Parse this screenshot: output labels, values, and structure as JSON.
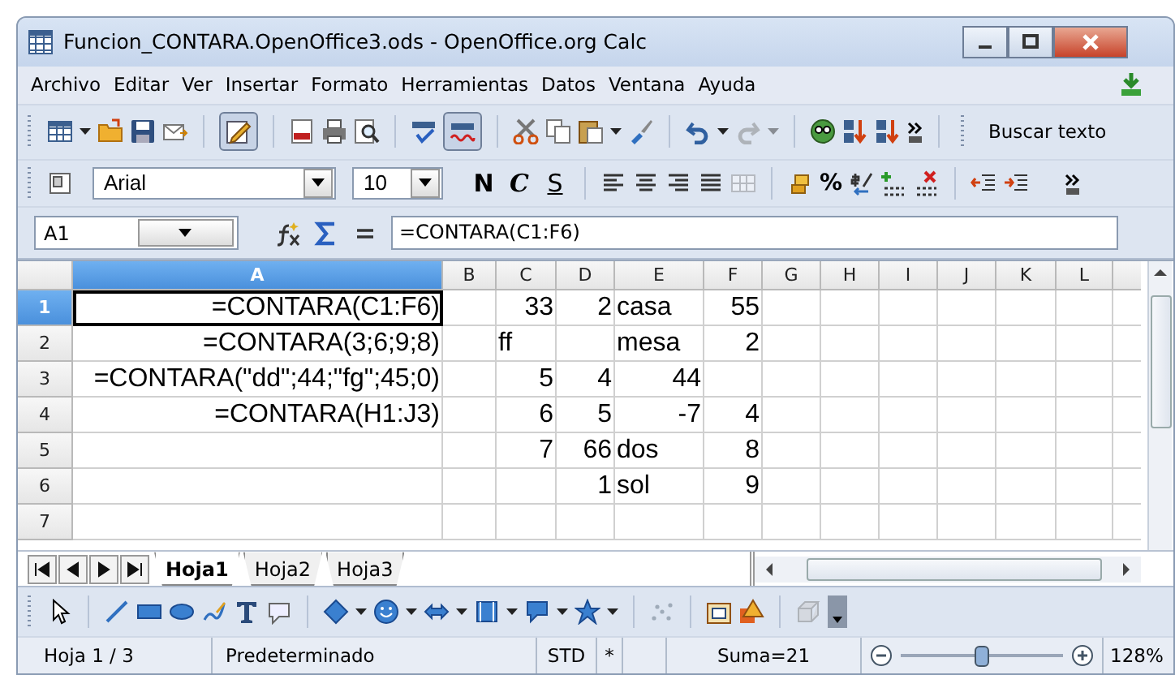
{
  "window": {
    "title": "Funcion_CONTARA.OpenOffice3.ods - OpenOffice.org Calc"
  },
  "menu": [
    {
      "label": "Archivo"
    },
    {
      "label": "Editar"
    },
    {
      "label": "Ver"
    },
    {
      "label": "Insertar"
    },
    {
      "label": "Formato"
    },
    {
      "label": "Herramientas"
    },
    {
      "label": "Datos"
    },
    {
      "label": "Ventana"
    },
    {
      "label": "Ayuda"
    }
  ],
  "standard_toolbar": {
    "edit_mode_pressed": true,
    "autospell_pressed": true,
    "redo_disabled": true,
    "search": {
      "placeholder": "Buscar texto"
    }
  },
  "formatting_toolbar": {
    "font": "Arial",
    "size": "10",
    "style_buttons": [
      {
        "label": "N",
        "kind": "bold"
      },
      {
        "label": "C",
        "kind": "italic"
      },
      {
        "label": "S",
        "kind": "underline"
      }
    ],
    "percent_button": "%",
    "merge_disabled": true
  },
  "formula_bar": {
    "name_box": "A1",
    "formula": "=CONTARA(C1:F6)"
  },
  "sheet": {
    "columns": [
      {
        "label": "A",
        "selected": true
      },
      {
        "label": "B",
        "selected": false
      },
      {
        "label": "C",
        "selected": false
      },
      {
        "label": "D",
        "selected": false
      },
      {
        "label": "E",
        "selected": false
      },
      {
        "label": "F",
        "selected": false
      },
      {
        "label": "G",
        "selected": false
      },
      {
        "label": "H",
        "selected": false
      },
      {
        "label": "I",
        "selected": false
      },
      {
        "label": "J",
        "selected": false
      },
      {
        "label": "K",
        "selected": false
      },
      {
        "label": "L",
        "selected": false
      }
    ],
    "rows": [
      {
        "label": "1",
        "selected": true,
        "cells": [
          {
            "text": "=CONTARA(C1:F6)",
            "kind": "formula",
            "selected": true
          },
          null,
          {
            "text": "33",
            "kind": "number"
          },
          {
            "text": "2",
            "kind": "number"
          },
          {
            "text": "casa",
            "kind": "text"
          },
          {
            "text": "55",
            "kind": "number"
          }
        ]
      },
      {
        "label": "2",
        "selected": false,
        "cells": [
          {
            "text": "=CONTARA(3;6;9;8)",
            "kind": "formula",
            "selected": false
          },
          null,
          {
            "text": "ff",
            "kind": "text"
          },
          null,
          {
            "text": "mesa",
            "kind": "text"
          },
          {
            "text": "2",
            "kind": "number"
          }
        ]
      },
      {
        "label": "3",
        "selected": false,
        "cells": [
          {
            "text": "=CONTARA(\"dd\";44;\"fg\";45;0)",
            "kind": "formula",
            "selected": false
          },
          null,
          {
            "text": "5",
            "kind": "number"
          },
          {
            "text": "4",
            "kind": "number"
          },
          {
            "text": "44",
            "kind": "number"
          },
          null
        ]
      },
      {
        "label": "4",
        "selected": false,
        "cells": [
          {
            "text": "=CONTARA(H1:J3)",
            "kind": "formula",
            "selected": false
          },
          null,
          {
            "text": "6",
            "kind": "number"
          },
          {
            "text": "5",
            "kind": "number"
          },
          {
            "text": "-7",
            "kind": "number"
          },
          {
            "text": "4",
            "kind": "number"
          }
        ]
      },
      {
        "label": "5",
        "selected": false,
        "cells": [
          null,
          null,
          {
            "text": "7",
            "kind": "number"
          },
          {
            "text": "66",
            "kind": "number"
          },
          {
            "text": "dos",
            "kind": "text"
          },
          {
            "text": "8",
            "kind": "number"
          }
        ]
      },
      {
        "label": "6",
        "selected": false,
        "cells": [
          null,
          null,
          null,
          {
            "text": "1",
            "kind": "number"
          },
          {
            "text": "sol",
            "kind": "text"
          },
          {
            "text": "9",
            "kind": "number"
          }
        ]
      },
      {
        "label": "7",
        "selected": false,
        "cells": []
      }
    ]
  },
  "sheet_tabs": [
    {
      "label": "Hoja1",
      "selected": true
    },
    {
      "label": "Hoja2",
      "selected": false
    },
    {
      "label": "Hoja3",
      "selected": false
    }
  ],
  "status_bar": {
    "sheet": "Hoja 1 / 3",
    "page_style": "Predeterminado",
    "selection_mode": "STD",
    "modified": "*",
    "sum": "Suma=21",
    "zoom": {
      "level": 0.5,
      "reading": "128%"
    }
  }
}
